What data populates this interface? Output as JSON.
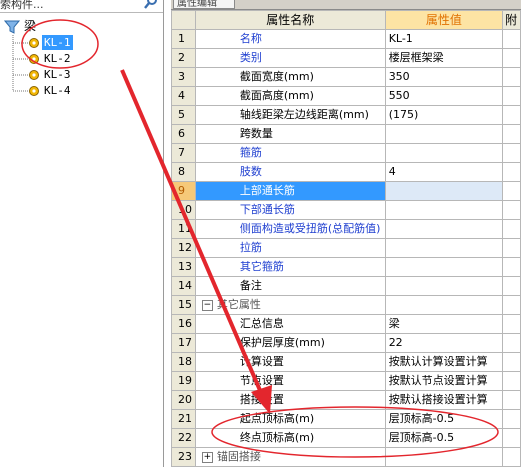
{
  "left_panel": {
    "search_text": "索构件...",
    "tree": {
      "root_label": "梁",
      "items": [
        {
          "label": "KL-1",
          "selected": true
        },
        {
          "label": "KL-2",
          "selected": false
        },
        {
          "label": "KL-3",
          "selected": false
        },
        {
          "label": "KL-4",
          "selected": false
        }
      ]
    }
  },
  "right_panel": {
    "tab_label": "属性编辑",
    "columns": {
      "name": "属性名称",
      "value": "属性值",
      "extra": "附"
    },
    "rows": [
      {
        "num": "1",
        "name": "名称",
        "value": "KL-1",
        "style": "blue"
      },
      {
        "num": "2",
        "name": "类别",
        "value": "楼层框架梁",
        "style": "blue"
      },
      {
        "num": "3",
        "name": "截面宽度(mm)",
        "value": "350",
        "style": "black"
      },
      {
        "num": "4",
        "name": "截面高度(mm)",
        "value": "550",
        "style": "black"
      },
      {
        "num": "5",
        "name": "轴线距梁左边线距离(mm)",
        "value": "(175)",
        "style": "black"
      },
      {
        "num": "6",
        "name": "跨数量",
        "value": "",
        "style": "black"
      },
      {
        "num": "7",
        "name": "箍筋",
        "value": "",
        "style": "blue"
      },
      {
        "num": "8",
        "name": "肢数",
        "value": "4",
        "style": "blue"
      },
      {
        "num": "9",
        "name": "上部通长筋",
        "value": "",
        "style": "selected"
      },
      {
        "num": "10",
        "name": "下部通长筋",
        "value": "",
        "style": "blue"
      },
      {
        "num": "11",
        "name": "侧面构造或受扭筋(总配筋值)",
        "value": "",
        "style": "blue"
      },
      {
        "num": "12",
        "name": "拉筋",
        "value": "",
        "style": "blue"
      },
      {
        "num": "13",
        "name": "其它箍筋",
        "value": "",
        "style": "blue"
      },
      {
        "num": "14",
        "name": "备注",
        "value": "",
        "style": "black"
      },
      {
        "num": "15",
        "name": "其它属性",
        "value": "",
        "style": "group",
        "expander": "−"
      },
      {
        "num": "16",
        "name": "汇总信息",
        "value": "梁",
        "style": "child"
      },
      {
        "num": "17",
        "name": "保护层厚度(mm)",
        "value": "22",
        "style": "child"
      },
      {
        "num": "18",
        "name": "计算设置",
        "value": "按默认计算设置计算",
        "style": "child"
      },
      {
        "num": "19",
        "name": "节点设置",
        "value": "按默认节点设置计算",
        "style": "child"
      },
      {
        "num": "20",
        "name": "搭接设置",
        "value": "按默认搭接设置计算",
        "style": "child"
      },
      {
        "num": "21",
        "name": "起点顶标高(m)",
        "value": "层顶标高-0.5",
        "style": "child"
      },
      {
        "num": "22",
        "name": "终点顶标高(m)",
        "value": "层顶标高-0.5",
        "style": "child"
      },
      {
        "num": "23",
        "name": "锚固搭接",
        "value": "",
        "style": "group",
        "expander": "+"
      }
    ]
  },
  "colors": {
    "selection_blue": "#3399ff",
    "header_value_bg": "#fde4a4",
    "link_blue": "#1f3fd0",
    "annotation_red": "#e3262d"
  },
  "icons": {
    "search": "magnifier-icon",
    "root": "funnel-icon",
    "item": "gear-icon"
  }
}
